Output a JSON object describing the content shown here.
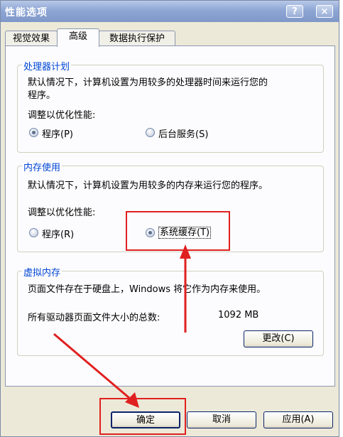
{
  "window": {
    "title": "性能选项",
    "help_button": "?",
    "close_button": "×"
  },
  "tabs": [
    {
      "label": "视觉效果"
    },
    {
      "label": "高级"
    },
    {
      "label": "数据执行保护"
    }
  ],
  "processor": {
    "legend": "处理器计划",
    "desc_line1": "默认情况下，计算机设置为用较多的处理器时间来运行您的",
    "desc_line2": "程序。",
    "adjust_label": "调整以优化性能:",
    "option_programs": "程序(P)",
    "option_background": "后台服务(S)"
  },
  "memory": {
    "legend": "内存使用",
    "desc": "默认情况下，计算机设置为用较多的内存来运行您的程序。",
    "adjust_label": "调整以优化性能:",
    "option_programs": "程序(R)",
    "option_system_cache": "系统缓存(T)"
  },
  "virtual_memory": {
    "legend": "虚拟内存",
    "desc": "页面文件存在于硬盘上，Windows 将它作为内存来使用。",
    "total_label": "所有驱动器页面文件大小的总数:",
    "total_value": "1092 MB",
    "change_button": "更改(C)"
  },
  "footer": {
    "ok_button": "确定",
    "cancel_button": "取消",
    "apply_button": "应用(A)"
  },
  "colors": {
    "annotation": "#e02020",
    "legend_text": "#0046d5"
  }
}
